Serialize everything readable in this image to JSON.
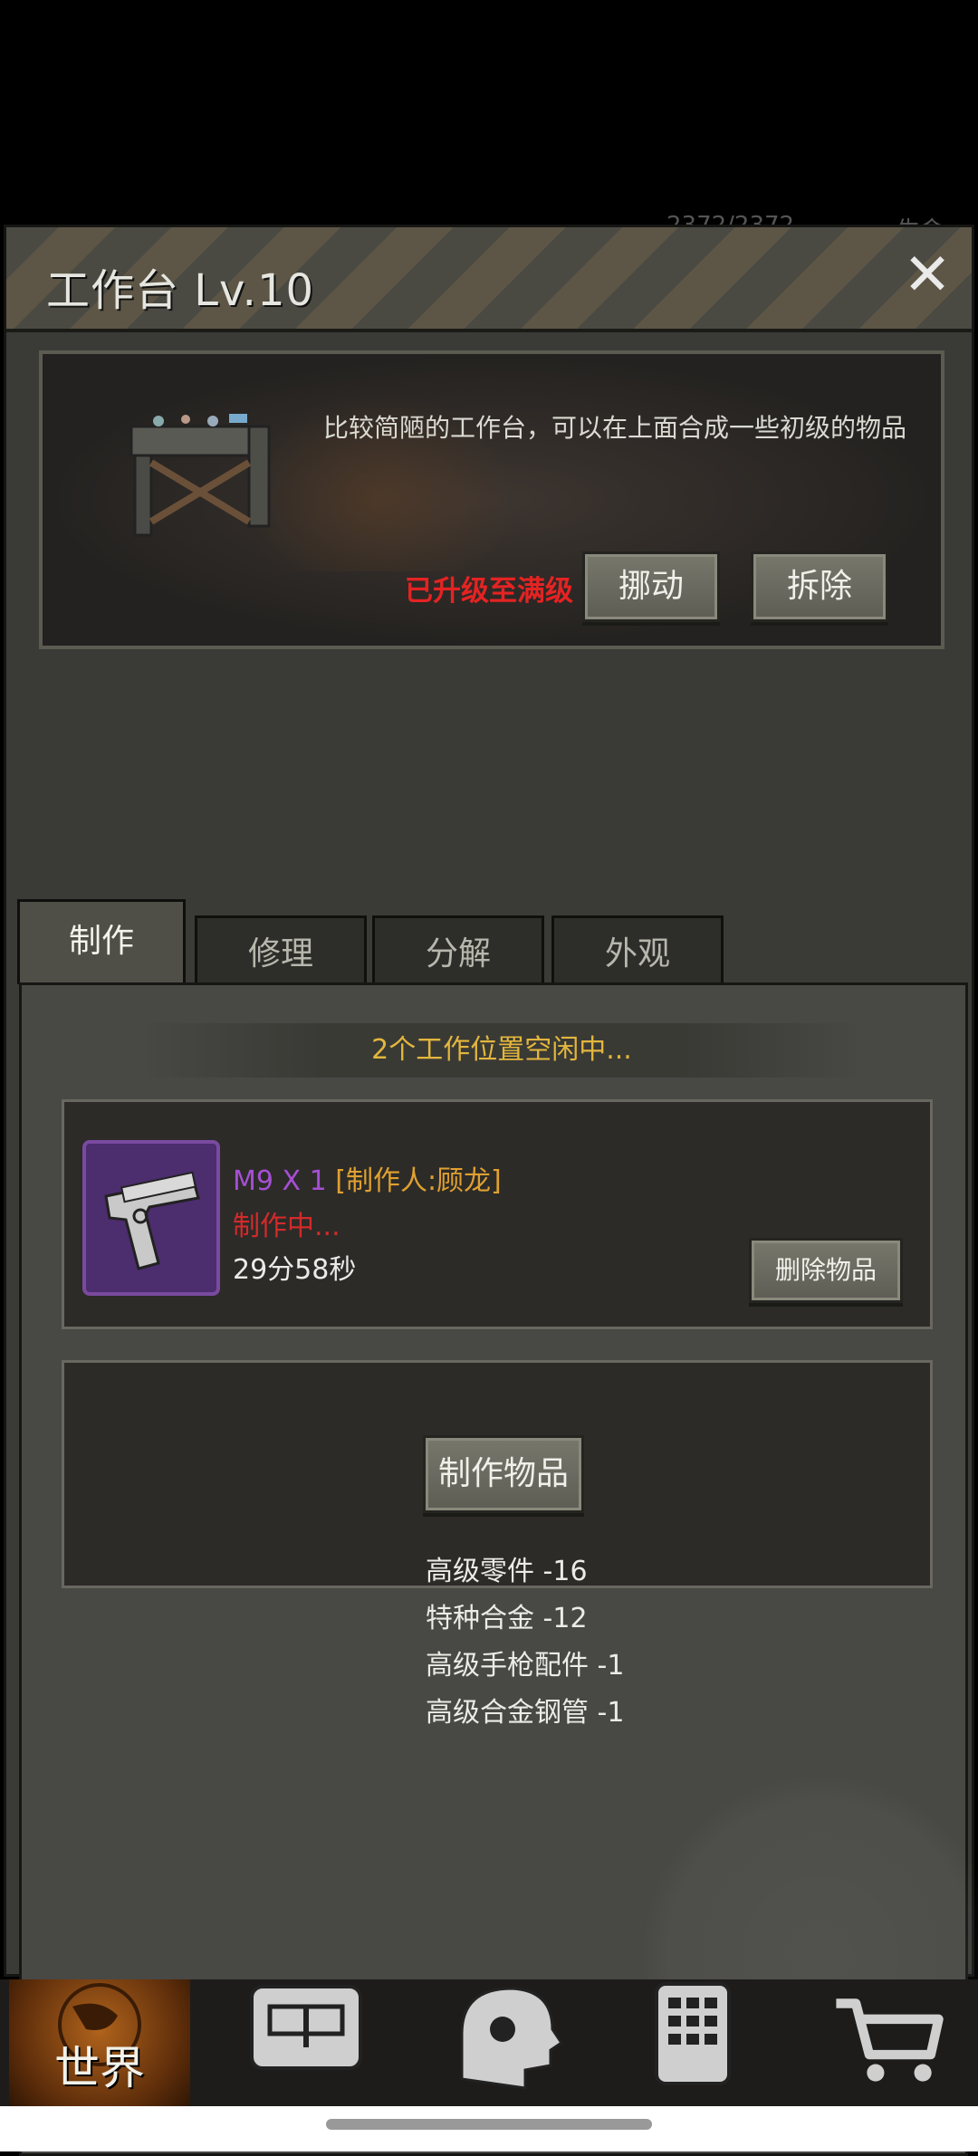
{
  "hud": {
    "stat_peek": "2372/2372",
    "life_peek": "生命"
  },
  "window": {
    "title": "工作台 Lv.10",
    "close_symbol": "✕"
  },
  "info": {
    "description": "比较简陋的工作台，可以在上面合成一些初级的物品",
    "max_level_text": "已升级至满级",
    "move_label": "挪动",
    "dismantle_label": "拆除"
  },
  "tabs": [
    {
      "label": "制作",
      "active": true
    },
    {
      "label": "修理",
      "active": false
    },
    {
      "label": "分解",
      "active": false
    },
    {
      "label": "外观",
      "active": false
    }
  ],
  "craft": {
    "slots_status": "2个工作位置空闲中...",
    "job": {
      "item": "M9 X 1",
      "crafter": "[制作人:顾龙]",
      "status": "制作中...",
      "time_left": "29分58秒",
      "delete_label": "删除物品"
    },
    "make_label": "制作物品",
    "requirements": [
      "高级零件 -16",
      "特种合金 -12",
      "高级手枪配件 -1",
      "高级合金钢管 -1"
    ]
  },
  "nav": {
    "world_label": "世界",
    "icons": [
      "backpack-icon",
      "head-gear-icon",
      "calculator-icon",
      "cart-icon"
    ]
  },
  "colors": {
    "accent_gold": "#e3b63d",
    "alert_red": "#e42323",
    "rare_purple": "#a64fd4"
  }
}
